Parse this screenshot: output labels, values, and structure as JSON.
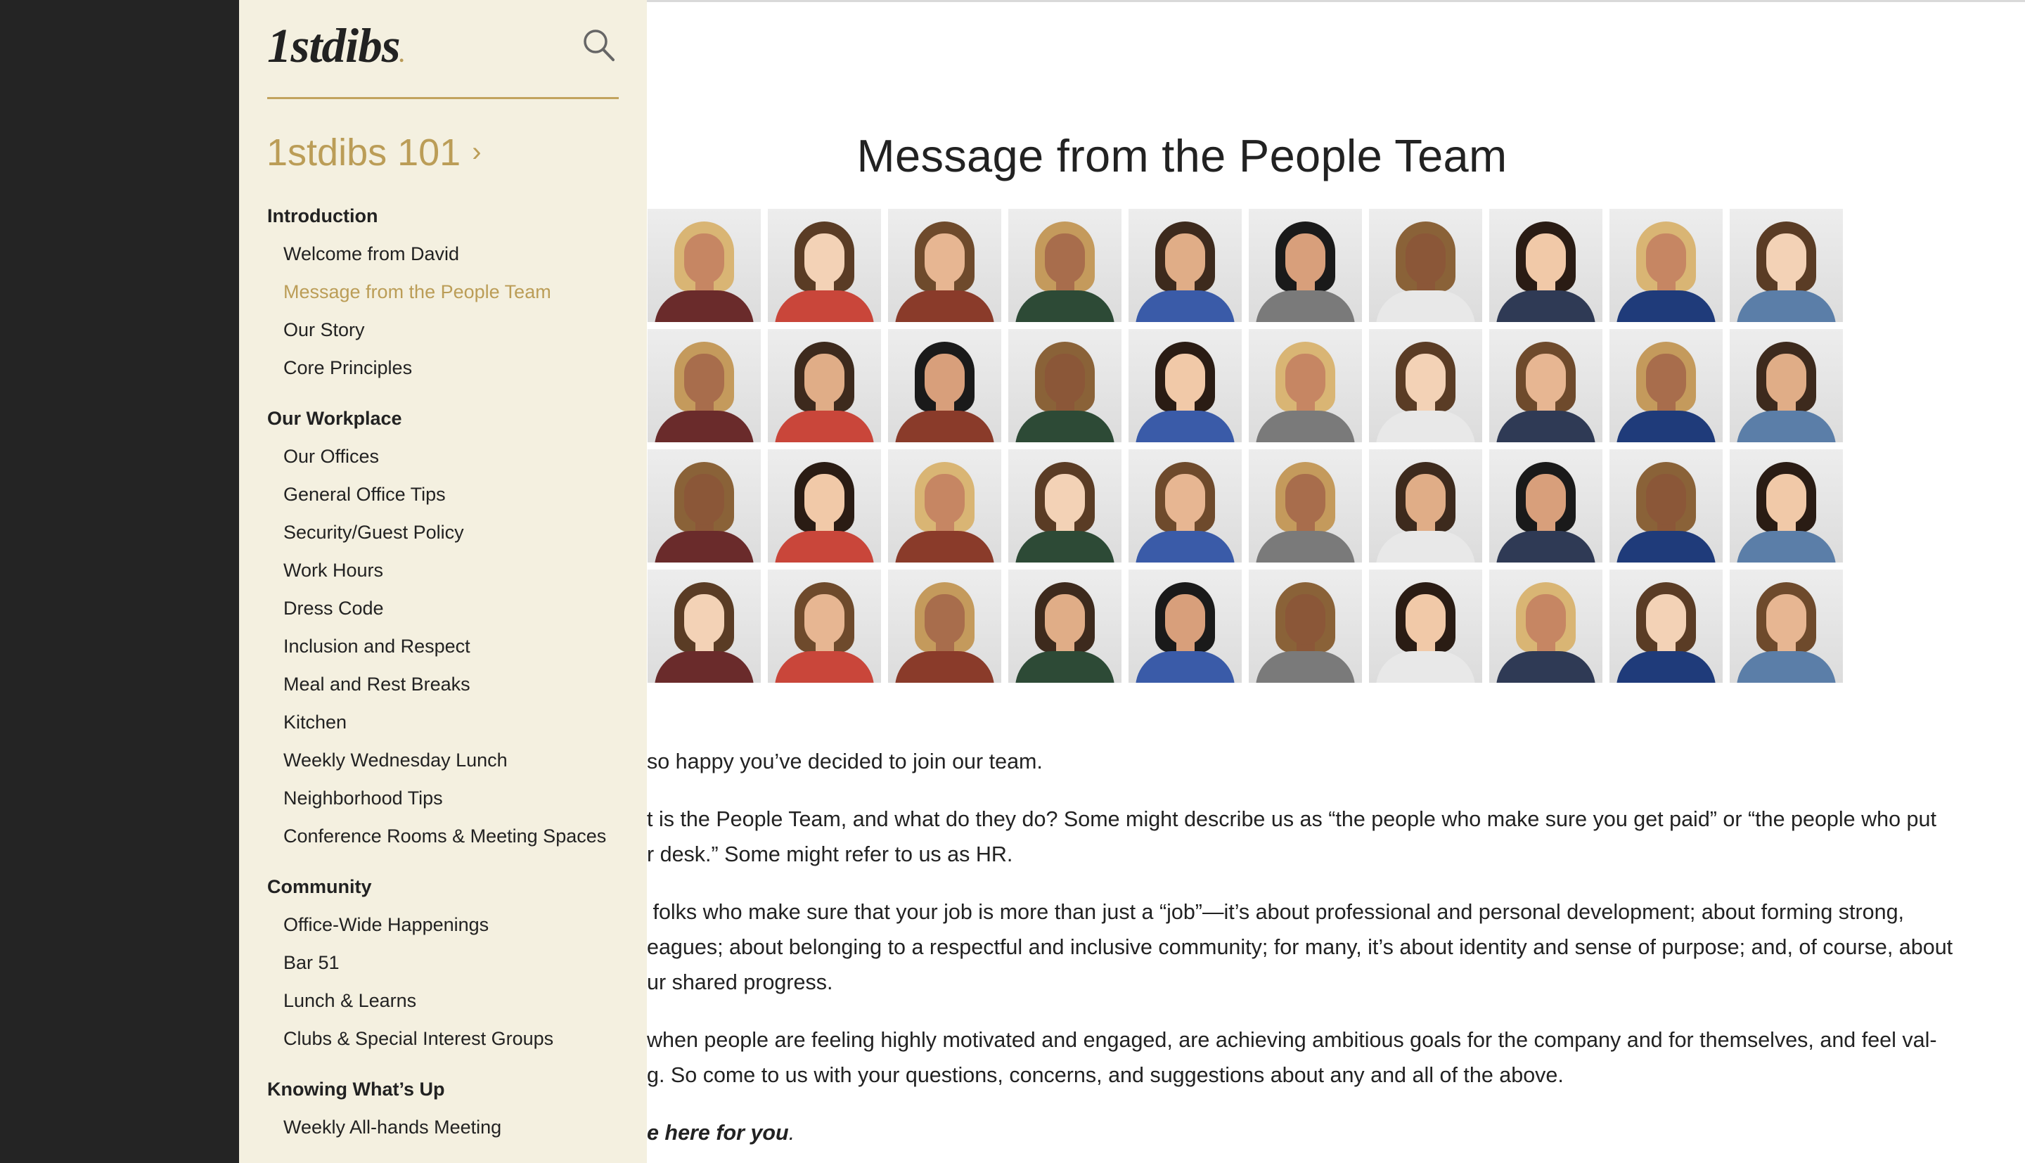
{
  "sidebar": {
    "logo": "1stdibs",
    "logo_dot": ".",
    "section_link": "1stdibs 101",
    "groups": [
      {
        "heading": "Introduction",
        "items": [
          "Welcome from David",
          "Message from the People Team",
          "Our Story",
          "Core Principles"
        ]
      },
      {
        "heading": "Our Workplace",
        "items": [
          "Our Offices",
          "General Office Tips",
          "Security/Guest Policy",
          "Work Hours",
          "Dress Code",
          "Inclusion and Respect",
          "Meal and Rest Breaks",
          "Kitchen",
          "Weekly Wednesday Lunch",
          "Neighborhood Tips",
          "Conference Rooms & Meeting Spaces"
        ]
      },
      {
        "heading": "Community",
        "items": [
          "Office-Wide Happenings",
          "Bar 51",
          "Lunch & Learns",
          "Clubs & Special Interest Groups"
        ]
      },
      {
        "heading": "Knowing What’s Up",
        "items": [
          "Weekly All-hands Meeting"
        ]
      }
    ],
    "active_item": "Message from the People Team"
  },
  "main": {
    "title": "Message from the People Team",
    "paragraphs": [
      "so happy you’ve decided to join our team.",
      "t is the People Team, and what do they do? Some might describe us as “the people who make sure you get paid” or “the people who put\nr desk.” Some might refer to us as HR.",
      " folks who make sure that your job is more than just a “job”—it’s about professional and personal development; about forming strong,\neagues; about belonging to a respectful and inclusive community; for many, it’s about identity and sense of purpose; and, of course, about\nur shared progress.",
      "when people are feeling highly motivated and engaged, are achieving ambitious goals for the company and for themselves, and feel val-\ng. So come to us with your questions, concerns, and suggestions about any and all of the above."
    ],
    "closing_emphasis": "e here for you",
    "closing_tail": "."
  },
  "colors": {
    "accent_gold": "#bb9d57",
    "sidebar_bg": "#f4f0e0",
    "gutter": "#242424",
    "text": "#222222"
  },
  "icons": {
    "search": "search-icon",
    "chevron": "chevron-right-icon"
  }
}
